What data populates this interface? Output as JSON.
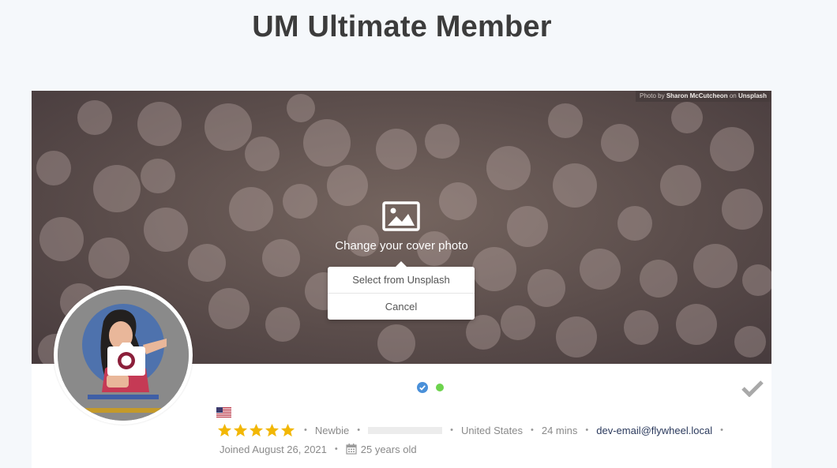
{
  "page": {
    "title": "UM Ultimate Member"
  },
  "cover": {
    "credit": {
      "prefix": "Photo by",
      "author": "Sharon McCutcheon",
      "middle": "on",
      "source": "Unsplash"
    },
    "change_text": "Change your cover photo",
    "menu": {
      "select_unsplash": "Select from Unsplash",
      "cancel": "Cancel"
    },
    "background_color": "#5b4d4b"
  },
  "profile": {
    "status": {
      "verified_color": "#4a90d9",
      "online_color": "#6dd34d"
    },
    "rating": {
      "value": 5,
      "max": 5,
      "star_color": "#f2b705"
    },
    "role": "Newbie",
    "country": "United States",
    "last_seen": "24 mins",
    "email": "dev-email@flywheel.local",
    "joined": "Joined August 26, 2021",
    "age": "25 years old",
    "link_color": "#2b3a5d"
  },
  "icons": {
    "cover": "image-icon",
    "avatar": "camera-icon",
    "check": "checkmark-icon",
    "flag": "us-flag-icon",
    "verified": "verified-badge-icon",
    "calendar": "calendar-icon"
  }
}
